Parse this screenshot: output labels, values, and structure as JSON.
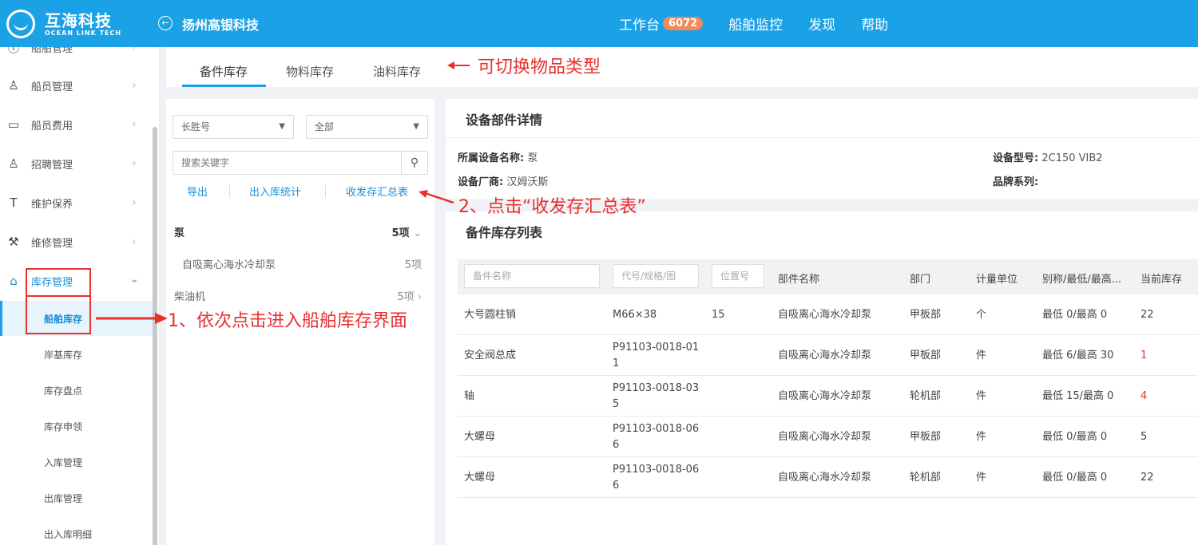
{
  "header": {
    "logo_cn": "互海科技",
    "logo_en": "OCEAN LINK TECH",
    "back_symbol": "←",
    "company": "扬州高银科技",
    "nav": [
      {
        "label": "工作台",
        "badge": "6072"
      },
      {
        "label": "船舶监控"
      },
      {
        "label": "发现"
      },
      {
        "label": "帮助"
      }
    ]
  },
  "sidebar": {
    "items": [
      {
        "label": "船舶管理",
        "icon": "info-icon"
      },
      {
        "label": "船员管理",
        "icon": "user-icon"
      },
      {
        "label": "船员费用",
        "icon": "wallet-icon"
      },
      {
        "label": "招聘管理",
        "icon": "recruit-icon"
      },
      {
        "label": "维护保养",
        "icon": "hammer-icon"
      },
      {
        "label": "维修管理",
        "icon": "wrench-icon"
      },
      {
        "label": "库存管理",
        "icon": "home-icon"
      }
    ],
    "sub_items": [
      "船舶库存",
      "岸基库存",
      "库存盘点",
      "库存申领",
      "入库管理",
      "出库管理",
      "出入库明细"
    ]
  },
  "tabs": [
    "备件库存",
    "物料库存",
    "油料库存"
  ],
  "filters": {
    "ship_select": "长胜号",
    "dept_select": "全部",
    "search_placeholder": "搜索关键字"
  },
  "actions": [
    "导出",
    "出入库统计",
    "收发存汇总表"
  ],
  "groups": [
    {
      "name": "泵",
      "count": "5项",
      "expanded": true
    },
    {
      "name": "自吸离心海水冷却泵",
      "count": "5项",
      "sub": true
    },
    {
      "name": "柴油机",
      "count": "5项",
      "expanded": false
    }
  ],
  "detail": {
    "title": "设备部件详情",
    "fields": {
      "device_name_label": "所属设备名称:",
      "device_name": "泵",
      "model_label": "设备型号:",
      "model": "2C150 VIB2",
      "maker_label": "设备厂商:",
      "maker": "汉姆沃斯",
      "brand_label": "品牌系列:",
      "brand": ""
    }
  },
  "list": {
    "title": "备件库存列表",
    "filter_placeholders": [
      "备件名称",
      "代号/规格/图",
      "位置号"
    ],
    "columns": [
      "部件名称",
      "部门",
      "计量单位",
      "别称/最低/最高...",
      "当前库存"
    ],
    "rows": [
      {
        "name": "大号圆柱销",
        "code": "M66×38",
        "code2": "",
        "pos": "15",
        "part": "自吸离心海水冷却泵",
        "dept": "甲板部",
        "unit": "个",
        "range": "最低 0/最高 0",
        "stock": "22",
        "low": false
      },
      {
        "name": "安全阀总成",
        "code": "P91103-0018-01",
        "code2": "1",
        "pos": "",
        "part": "自吸离心海水冷却泵",
        "dept": "甲板部",
        "unit": "件",
        "range": "最低 6/最高 30",
        "stock": "1",
        "low": true
      },
      {
        "name": "轴",
        "code": "P91103-0018-03",
        "code2": "5",
        "pos": "",
        "part": "自吸离心海水冷却泵",
        "dept": "轮机部",
        "unit": "件",
        "range": "最低 15/最高 0",
        "stock": "4",
        "low": true
      },
      {
        "name": "大螺母",
        "code": "P91103-0018-06",
        "code2": "6",
        "pos": "",
        "part": "自吸离心海水冷却泵",
        "dept": "甲板部",
        "unit": "件",
        "range": "最低 0/最高 0",
        "stock": "5",
        "low": false
      },
      {
        "name": "大螺母",
        "code": "P91103-0018-06",
        "code2": "6",
        "pos": "",
        "part": "自吸离心海水冷却泵",
        "dept": "轮机部",
        "unit": "件",
        "range": "最低 0/最高 0",
        "stock": "22",
        "low": false
      }
    ]
  },
  "annotations": {
    "tab_hint": "可切换物品类型",
    "step1": "1、依次点击进入船舶库存界面",
    "step2": "2、点击“收发存汇总表”",
    "color": "#e8302f"
  }
}
